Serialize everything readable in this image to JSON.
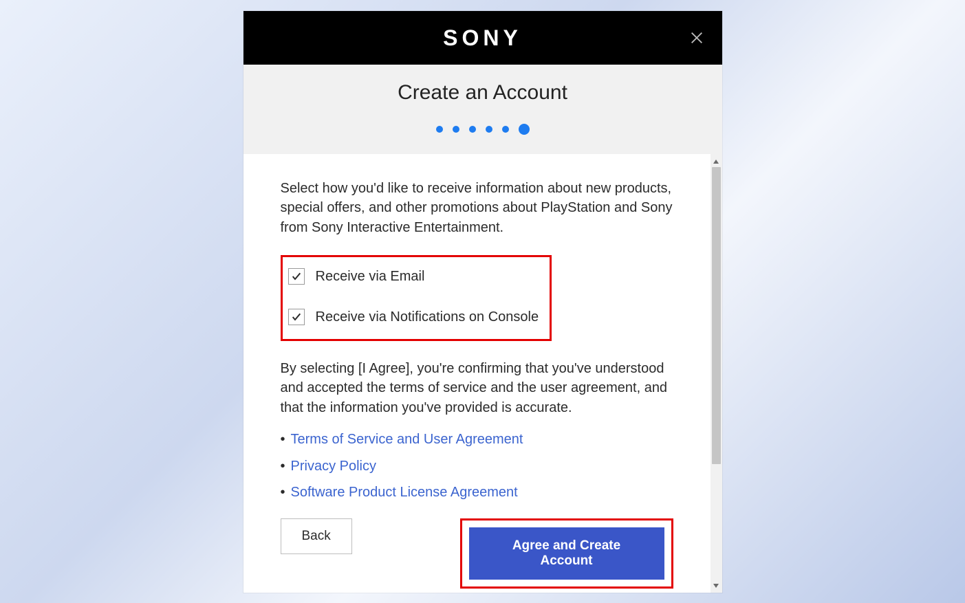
{
  "header": {
    "brand": "SONY"
  },
  "title": "Create an Account",
  "steps": {
    "total": 6,
    "current": 6
  },
  "intro": "Select how you'd like to receive information about new products, special offers, and other promotions about PlayStation and Sony from Sony Interactive Entertainment.",
  "checkboxes": {
    "email": {
      "label": "Receive via Email",
      "checked": true
    },
    "console": {
      "label": "Receive via Notifications on Console",
      "checked": true
    }
  },
  "agree_text": "By selecting [I Agree], you're confirming that you've understood and accepted the terms of service and the user agreement, and that the information you've provided is accurate.",
  "links": {
    "tos": "Terms of Service and User Agreement",
    "privacy": "Privacy Policy",
    "license": "Software Product License Agreement"
  },
  "buttons": {
    "back": "Back",
    "primary": "Agree and Create Account"
  }
}
